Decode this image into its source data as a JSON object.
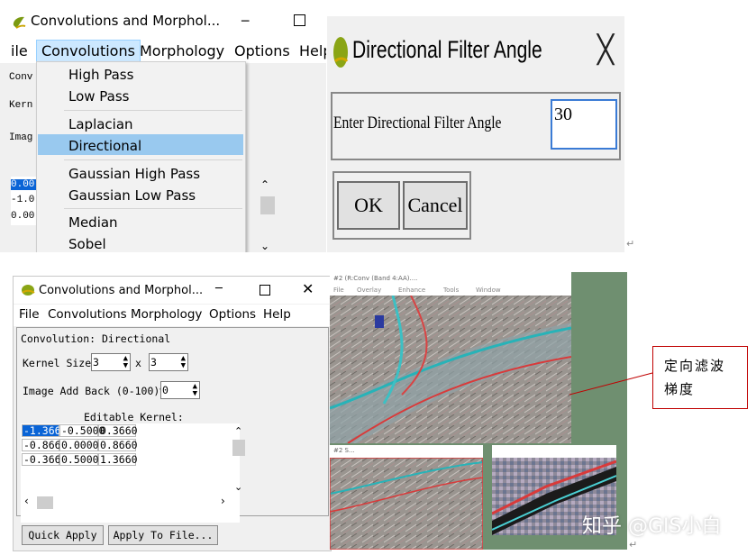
{
  "menu_panel": {
    "window_title": "Convolutions and Morphol...",
    "menubar": [
      "ile",
      "Convolutions",
      "Morphology",
      "Options",
      "Help"
    ],
    "partial_labels": [
      "Conv",
      "Kern",
      "Imag"
    ],
    "partial_values": [
      "0.00",
      "-1.0",
      "0.00"
    ],
    "dropdown": [
      "High Pass",
      "Low Pass",
      "Laplacian",
      "Directional",
      "Gaussian High Pass",
      "Gaussian Low Pass",
      "Median",
      "Sobel"
    ],
    "selected_item": "Directional"
  },
  "dialog": {
    "title": "Directional Filter Angle",
    "prompt": "Enter Directional Filter Angle",
    "angle_value": "30",
    "ok_label": "OK",
    "cancel_label": "Cancel"
  },
  "main_window": {
    "title": "Convolutions and Morphol...",
    "menubar": [
      "File",
      "Convolutions",
      "Morphology",
      "Options",
      "Help"
    ],
    "convolution_label": "Convolution: Directional",
    "kernel_size_label": "Kernel Size",
    "kernel_size_x": "3",
    "kernel_size_sep": "x",
    "kernel_size_y": "3",
    "add_back_label": "Image Add Back (0-100)%",
    "add_back_value": "0",
    "editable_kernel_label": "Editable Kernel:",
    "kernel_rows": [
      [
        "-1.366",
        "-0.5000",
        "0.3660"
      ],
      [
        "-0.866",
        "0.0000",
        "0.8660"
      ],
      [
        "-0.366",
        "0.5000",
        "1.3660"
      ]
    ],
    "quick_apply_label": "Quick Apply",
    "apply_to_file_label": "Apply To File..."
  },
  "image_windows": {
    "main_title": "#2 (R:Conv (Band 4:AA)....",
    "main_menu": [
      "File",
      "Overlay",
      "Enhance",
      "Tools",
      "Window"
    ],
    "scroll_title": "#2 S...",
    "zoom_title": ""
  },
  "annotation": {
    "line1": "定向滤波",
    "line2": "梯度"
  },
  "watermark": "知乎 @GIS小白",
  "colors": {
    "selection_blue": "#0a64d6",
    "menu_highlight": "#99c9ef",
    "annotation_red": "#c00000",
    "input_focus": "#3a7bd5"
  }
}
